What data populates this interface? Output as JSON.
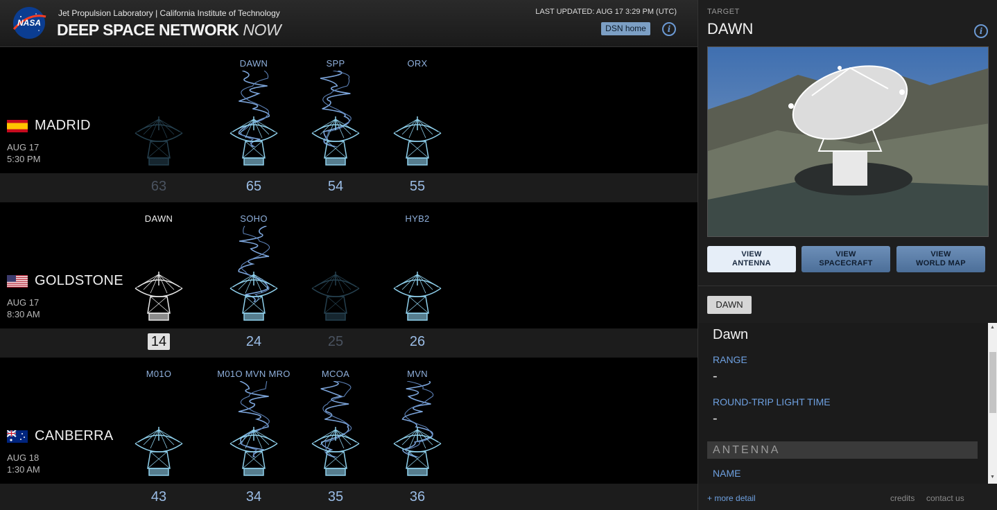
{
  "header": {
    "jpl_line": "Jet Propulsion Laboratory | California Institute of Technology",
    "title_main": "DEEP SPACE NETWORK",
    "title_now": "NOW",
    "last_updated": "LAST UPDATED: AUG 17 3:29 PM (UTC)",
    "home_button": "DSN home",
    "logo_text": "NASA"
  },
  "colors": {
    "accent_blue": "#6ea0e0",
    "dish_active": "#8fd0ec",
    "dish_dim": "#2a4858",
    "dish_selected": "#e8e8e8"
  },
  "stations": [
    {
      "name": "MADRID",
      "date": "AUG 17",
      "time": "5:30 PM",
      "flag": "spain-flag",
      "antennas": [
        {
          "number": "63",
          "label": "",
          "state": "dim",
          "signal": false
        },
        {
          "number": "65",
          "label": "DAWN",
          "state": "active",
          "signal": true
        },
        {
          "number": "54",
          "label": "SPP",
          "state": "active",
          "signal": true
        },
        {
          "number": "55",
          "label": "ORX",
          "state": "active",
          "signal": false
        }
      ]
    },
    {
      "name": "GOLDSTONE",
      "date": "AUG 17",
      "time": "8:30 AM",
      "flag": "usa-flag",
      "antennas": [
        {
          "number": "14",
          "label": "DAWN",
          "state": "selected",
          "signal": false
        },
        {
          "number": "24",
          "label": "SOHO",
          "state": "active",
          "signal": true
        },
        {
          "number": "25",
          "label": "",
          "state": "dim",
          "signal": false
        },
        {
          "number": "26",
          "label": "HYB2",
          "state": "active",
          "signal": false
        }
      ]
    },
    {
      "name": "CANBERRA",
      "date": "AUG 18",
      "time": "1:30 AM",
      "flag": "australia-flag",
      "antennas": [
        {
          "number": "43",
          "label": "M01O",
          "state": "active",
          "signal": false
        },
        {
          "number": "34",
          "label": "M01O  MVN  MRO",
          "state": "active",
          "signal": true
        },
        {
          "number": "35",
          "label": "MCOA",
          "state": "active",
          "signal": true
        },
        {
          "number": "36",
          "label": "MVN",
          "state": "active",
          "signal": true
        }
      ]
    }
  ],
  "panel": {
    "target_label": "TARGET",
    "target_name": "DAWN",
    "view_buttons": [
      {
        "line1": "VIEW",
        "line2": "ANTENNA"
      },
      {
        "line1": "VIEW",
        "line2": "SPACECRAFT"
      },
      {
        "line1": "VIEW",
        "line2": "WORLD MAP"
      }
    ],
    "tag": "DAWN",
    "details": {
      "title": "Dawn",
      "range_label": "RANGE",
      "range_value": "-",
      "rtlt_label": "ROUND-TRIP LIGHT TIME",
      "rtlt_value": "-",
      "antenna_header": "ANTENNA",
      "name_label": "NAME"
    },
    "more_detail": "+ more detail",
    "credits": "credits",
    "contact": "contact us"
  }
}
